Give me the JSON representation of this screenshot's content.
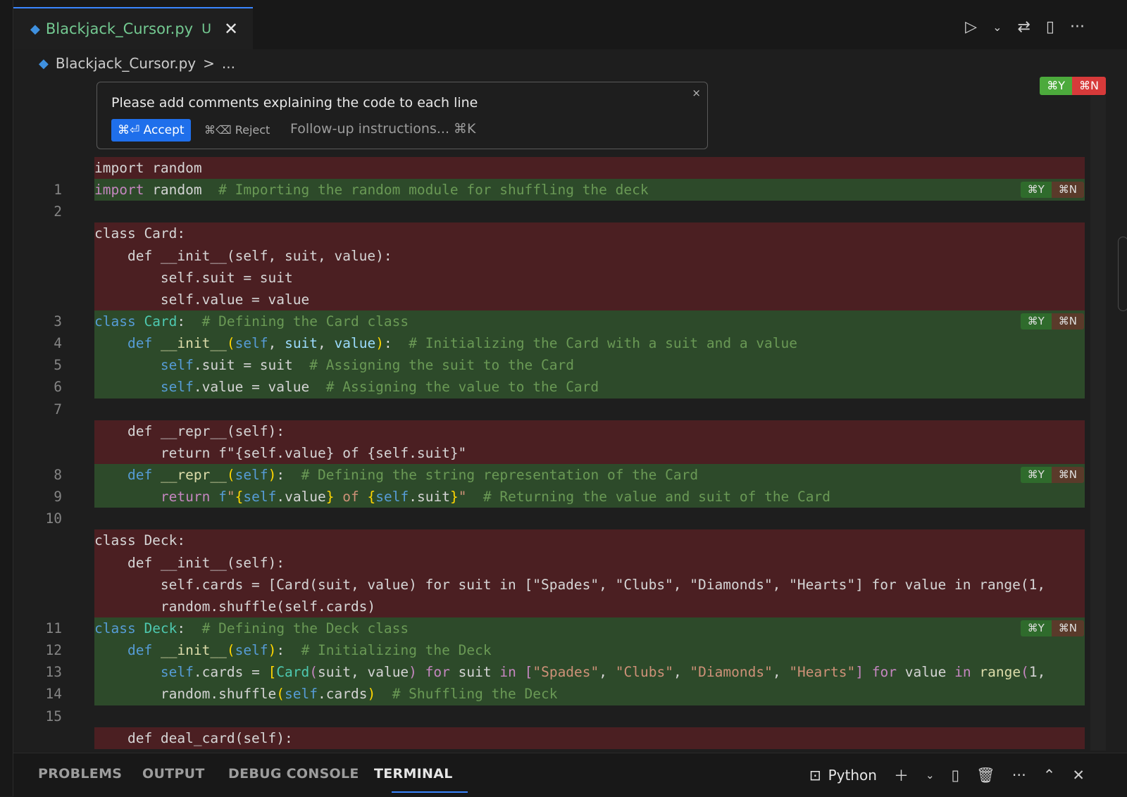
{
  "tab": {
    "filename": "Blackjack_Cursor.py",
    "status": "U",
    "icon": "python-file-icon"
  },
  "toolbar": {
    "run_icon": "▷",
    "dropdown_icon": "⌄",
    "compare_icon": "⇄",
    "split_icon": "▯",
    "more_icon": "···"
  },
  "breadcrumb": {
    "file": "Blackjack_Cursor.py",
    "separator": ">",
    "more": "..."
  },
  "prompt": {
    "text": "Please add comments explaining the code to each line",
    "accept": "⌘⏎ Accept",
    "reject": "⌘⌫ Reject",
    "followup_placeholder": "Follow-up instructions... ⌘K",
    "close": "×"
  },
  "diff_badges": {
    "accept": "⌘Y",
    "reject": "⌘N"
  },
  "colors": {
    "added": "#2d4a2a",
    "removed": "#4b1f22",
    "accent": "#3a86ff"
  },
  "code_lines": {
    "r1": "import random",
    "l1": "import random  # Importing the random module for shuffling the deck",
    "r3": [
      "class Card:",
      "    def __init__(self, suit, value):",
      "        self.suit = suit",
      "        self.value = value"
    ],
    "l3": "class Card:  # Defining the Card class",
    "l4": "    def __init__(self, suit, value):  # Initializing the Card with a suit and a value",
    "l5": "        self.suit = suit  # Assigning the suit to the Card",
    "l6": "        self.value = value  # Assigning the value to the Card",
    "r8": [
      "    def __repr__(self):",
      "        return f\"{self.value} of {self.suit}\""
    ],
    "l8": "    def __repr__(self):  # Defining the string representation of the Card",
    "l9": "        return f\"{self.value} of {self.suit}\"  # Returning the value and suit of the Card",
    "r11": [
      "class Deck:",
      "    def __init__(self):",
      "        self.cards = [Card(suit, value) for suit in [\"Spades\", \"Clubs\", \"Diamonds\", \"Hearts\"] for value in range(1,",
      "        random.shuffle(self.cards)"
    ],
    "l11": "class Deck:  # Defining the Deck class",
    "l12": "    def __init__(self):  # Initializing the Deck",
    "l13": "        self.cards = [Card(suit, value) for suit in [\"Spades\", \"Clubs\", \"Diamonds\", \"Hearts\"] for value in range(1,",
    "l14": "        random.shuffle(self.cards)  # Shuffling the Deck",
    "r16": "    def deal_card(self):"
  },
  "line_numbers": [
    "1",
    "2",
    "3",
    "4",
    "5",
    "6",
    "7",
    "8",
    "9",
    "10",
    "11",
    "12",
    "13",
    "14",
    "15"
  ],
  "panel": {
    "tabs": [
      "PROBLEMS",
      "OUTPUT",
      "DEBUG CONSOLE",
      "TERMINAL"
    ],
    "active_tab": "TERMINAL",
    "terminal_name": "Python",
    "icons": [
      "terminal-icon",
      "plus-icon",
      "chevron-down-icon",
      "split-icon",
      "trash-icon",
      "more-icon",
      "chevron-up-icon",
      "close-icon"
    ]
  }
}
